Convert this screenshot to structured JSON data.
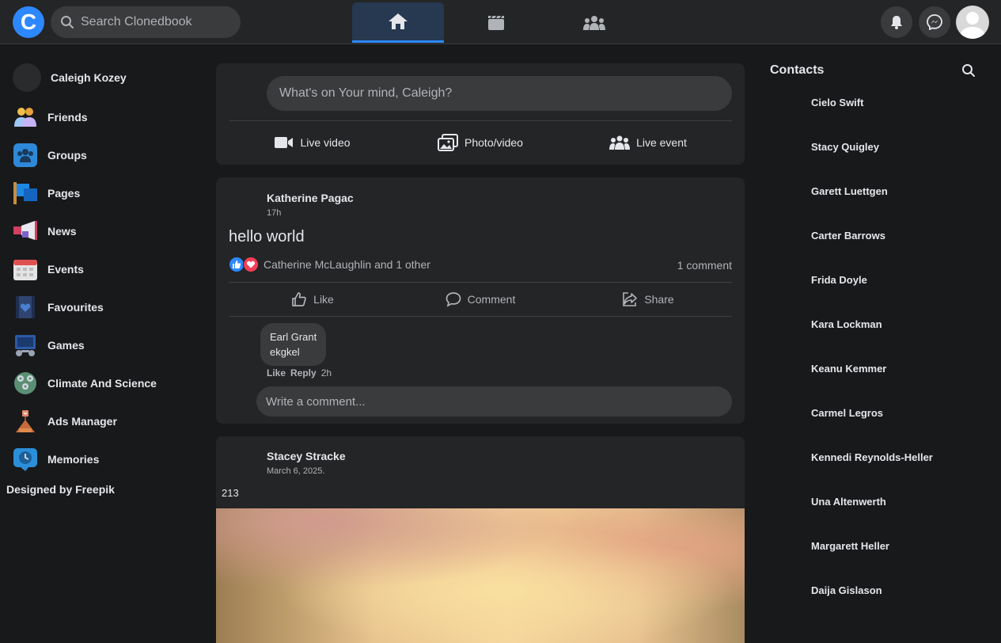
{
  "app": {
    "logo_letter": "C",
    "search_placeholder": "Search Clonedbook",
    "colors": {
      "accent": "#2d88ff",
      "background": "#18191a",
      "surface": "#242526"
    }
  },
  "topnav": {
    "tabs": [
      {
        "icon": "home-icon",
        "active": true
      },
      {
        "icon": "video-icon",
        "active": false
      },
      {
        "icon": "groups-icon",
        "active": false
      }
    ],
    "right_icons": [
      "bell-icon",
      "messenger-icon",
      "profile-avatar"
    ]
  },
  "sidebar": {
    "profile_name": "Caleigh Kozey",
    "items": [
      {
        "label": "Friends",
        "icon": "friends-icon"
      },
      {
        "label": "Groups",
        "icon": "groups-icon"
      },
      {
        "label": "Pages",
        "icon": "flag-icon"
      },
      {
        "label": "News",
        "icon": "megaphone-icon"
      },
      {
        "label": "Events",
        "icon": "calendar-icon"
      },
      {
        "label": "Favourites",
        "icon": "heart-film-icon"
      },
      {
        "label": "Games",
        "icon": "gamepad-icon"
      },
      {
        "label": "Climate And Science",
        "icon": "globe-icon"
      },
      {
        "label": "Ads Manager",
        "icon": "chart-icon"
      },
      {
        "label": "Memories",
        "icon": "clock-icon"
      }
    ],
    "credit": "Designed by Freepik"
  },
  "composer": {
    "placeholder": "What's on Your mind, Caleigh?",
    "actions": [
      {
        "label": "Live video",
        "icon": "video-camera-icon"
      },
      {
        "label": "Photo/video",
        "icon": "photos-icon"
      },
      {
        "label": "Live event",
        "icon": "people-icon"
      }
    ]
  },
  "posts": [
    {
      "author": "Katherine Pagac",
      "time": "17h",
      "text": "hello world",
      "reactions_text": "Catherine McLaughlin and 1 other",
      "comment_count": "1 comment",
      "actions": {
        "like": "Like",
        "comment": "Comment",
        "share": "Share"
      },
      "comments": [
        {
          "author": "Earl Grant",
          "text": "ekgkel",
          "like": "Like",
          "reply": "Reply",
          "time": "2h"
        }
      ],
      "write_placeholder": "Write a comment..."
    },
    {
      "author": "Stacey Stracke",
      "time": "March 6, 2025.",
      "text": "213"
    }
  ],
  "contacts": {
    "title": "Contacts",
    "names": [
      "Cielo Swift",
      "Stacy Quigley",
      "Garett Luettgen",
      "Carter Barrows",
      "Frida Doyle",
      "Kara Lockman",
      "Keanu Kemmer",
      "Carmel Legros",
      "Kennedi Reynolds-Heller",
      "Una Altenwerth",
      "Margarett Heller",
      "Daija Gislason"
    ]
  }
}
